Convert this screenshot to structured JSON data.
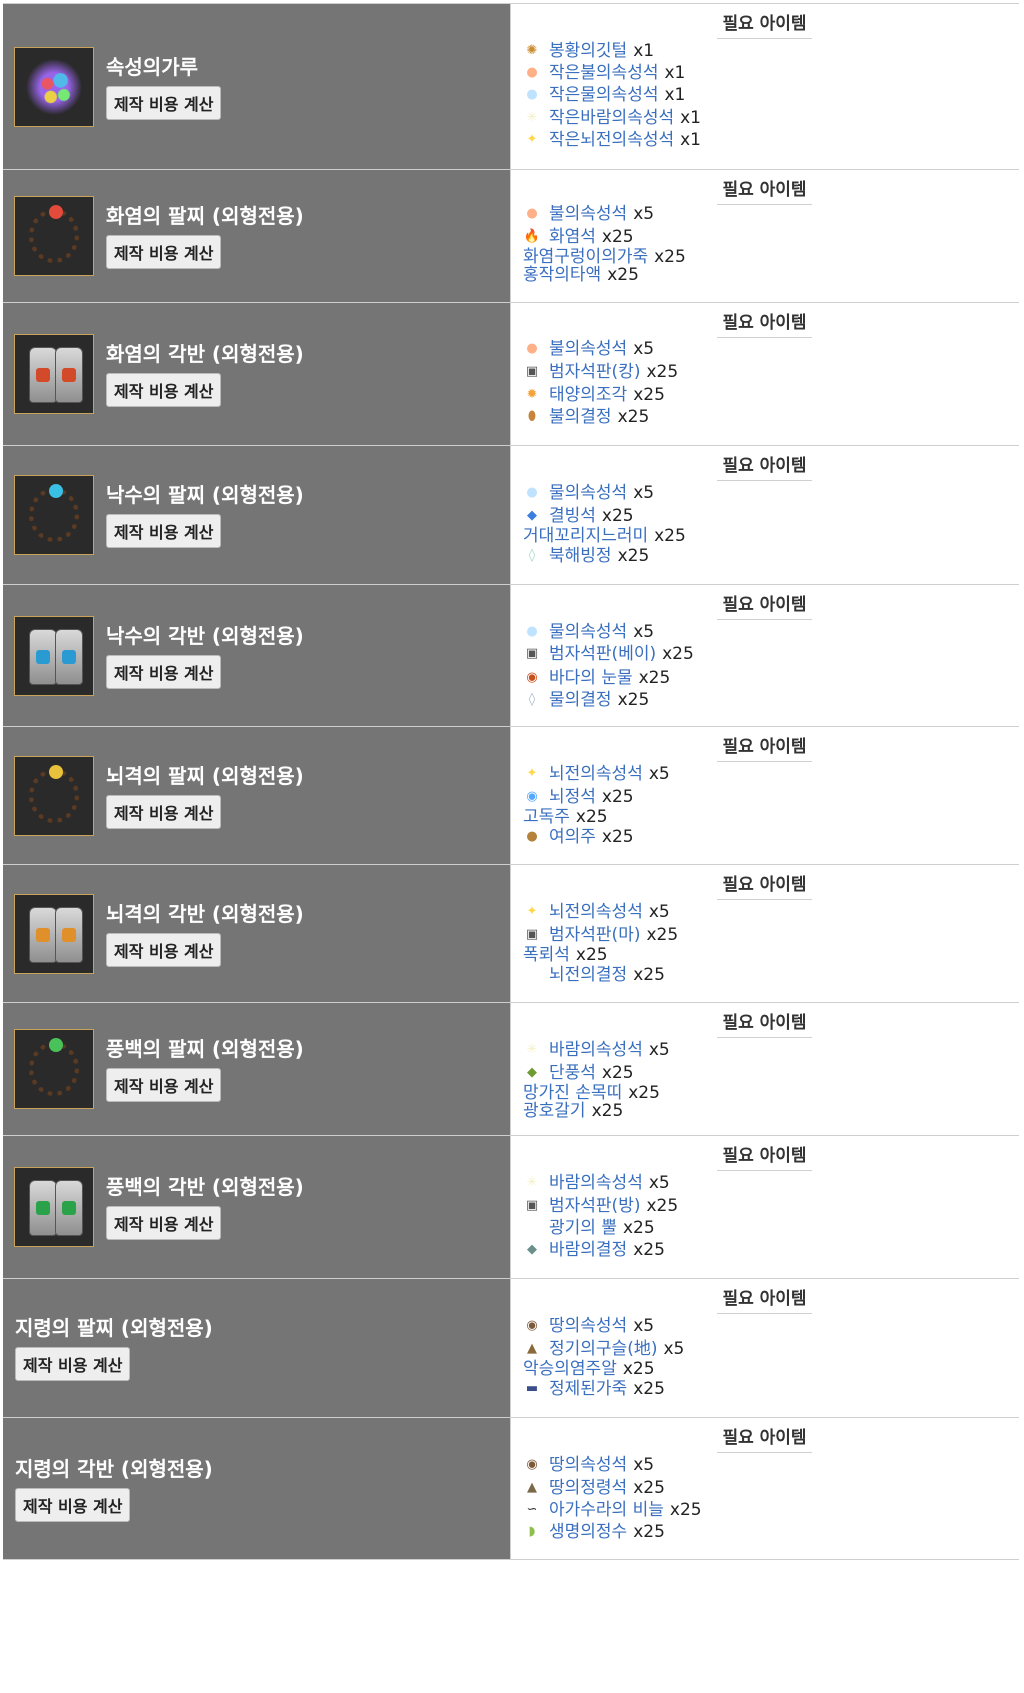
{
  "header_label": "필요 아이템",
  "button_label": "제작 비용 계산",
  "rows": [
    {
      "name": "속성의가루",
      "thumb": "powder",
      "materials": [
        {
          "icon": "feather-icon",
          "name": "봉황의깃털",
          "qty": "x1"
        },
        {
          "icon": "fire-stone-icon",
          "name": "작은불의속성석",
          "qty": "x1"
        },
        {
          "icon": "water-stone-icon",
          "name": "작은물의속성석",
          "qty": "x1"
        },
        {
          "icon": "wind-stone-icon",
          "name": "작은바람의속성석",
          "qty": "x1"
        },
        {
          "icon": "lightning-stone-icon",
          "name": "작은뇌전의속성석",
          "qty": "x1"
        }
      ]
    },
    {
      "name": "화염의 팔찌 (외형전용)",
      "thumb": "bracelet-red",
      "materials": [
        {
          "icon": "fire-stone-icon",
          "name": "불의속성석",
          "qty": "x5"
        },
        {
          "icon": "flame-stone-icon",
          "name": "화염석",
          "qty": "x25"
        },
        {
          "icon": "",
          "name": "화염구렁이의가죽",
          "qty": "x25"
        },
        {
          "icon": "",
          "name": "홍작의타액",
          "qty": "x25"
        }
      ]
    },
    {
      "name": "화염의 각반 (외형전용)",
      "thumb": "greaves-red",
      "materials": [
        {
          "icon": "fire-stone-icon",
          "name": "불의속성석",
          "qty": "x5"
        },
        {
          "icon": "tablet-icon",
          "name": "범자석판(캉)",
          "qty": "x25"
        },
        {
          "icon": "sun-shard-icon",
          "name": "태양의조각",
          "qty": "x25"
        },
        {
          "icon": "fire-crystal-icon",
          "name": "불의결정",
          "qty": "x25"
        }
      ]
    },
    {
      "name": "낙수의 팔찌 (외형전용)",
      "thumb": "bracelet-blue",
      "materials": [
        {
          "icon": "water-stone-icon",
          "name": "물의속성석",
          "qty": "x5"
        },
        {
          "icon": "ice-stone-icon",
          "name": "결빙석",
          "qty": "x25"
        },
        {
          "icon": "",
          "name": "거대꼬리지느러미",
          "qty": "x25"
        },
        {
          "icon": "ice-crystal-icon",
          "name": "북해빙정",
          "qty": "x25"
        }
      ]
    },
    {
      "name": "낙수의 각반 (외형전용)",
      "thumb": "greaves-blue",
      "materials": [
        {
          "icon": "water-stone-icon",
          "name": "물의속성석",
          "qty": "x5"
        },
        {
          "icon": "tablet-icon",
          "name": "범자석판(베이)",
          "qty": "x25"
        },
        {
          "icon": "tear-drop-icon",
          "name": "바다의 눈물",
          "qty": "x25"
        },
        {
          "icon": "water-crystal-icon",
          "name": "물의결정",
          "qty": "x25"
        }
      ]
    },
    {
      "name": "뇌격의 팔찌 (외형전용)",
      "thumb": "bracelet-yellow",
      "materials": [
        {
          "icon": "lightning-stone-icon",
          "name": "뇌전의속성석",
          "qty": "x5"
        },
        {
          "icon": "thunder-stone-icon",
          "name": "뇌정석",
          "qty": "x25"
        },
        {
          "icon": "",
          "name": "고독주",
          "qty": "x25"
        },
        {
          "icon": "orb-icon",
          "name": "여의주",
          "qty": "x25"
        }
      ]
    },
    {
      "name": "뇌격의 각반 (외형전용)",
      "thumb": "greaves-yellow",
      "materials": [
        {
          "icon": "lightning-stone-icon",
          "name": "뇌전의속성석",
          "qty": "x5"
        },
        {
          "icon": "tablet-icon",
          "name": "범자석판(마)",
          "qty": "x25"
        },
        {
          "icon": "",
          "name": "폭뢰석",
          "qty": "x25"
        },
        {
          "icon": "lightning-crystal-icon",
          "name": "뇌전의결정",
          "qty": "x25"
        }
      ]
    },
    {
      "name": "풍백의 팔찌 (외형전용)",
      "thumb": "bracelet-green",
      "materials": [
        {
          "icon": "wind-stone-icon",
          "name": "바람의속성석",
          "qty": "x5"
        },
        {
          "icon": "leaf-stone-icon",
          "name": "단풍석",
          "qty": "x25"
        },
        {
          "icon": "",
          "name": "망가진 손목띠",
          "qty": "x25"
        },
        {
          "icon": "",
          "name": "광호갈기",
          "qty": "x25"
        }
      ]
    },
    {
      "name": "풍백의 각반 (외형전용)",
      "thumb": "greaves-green",
      "materials": [
        {
          "icon": "wind-stone-icon",
          "name": "바람의속성석",
          "qty": "x5"
        },
        {
          "icon": "tablet-icon",
          "name": "범자석판(방)",
          "qty": "x25"
        },
        {
          "icon": "horn-icon",
          "name": "광기의 뿔",
          "qty": "x25"
        },
        {
          "icon": "wind-crystal-icon",
          "name": "바람의결정",
          "qty": "x25"
        }
      ]
    },
    {
      "name": "지령의 팔찌 (외형전용)",
      "thumb": "",
      "materials": [
        {
          "icon": "earth-stone-icon",
          "name": "땅의속성석",
          "qty": "x5"
        },
        {
          "icon": "energy-bead-icon",
          "name": "정기의구슬(地)",
          "qty": "x5"
        },
        {
          "icon": "",
          "name": "악승의염주알",
          "qty": "x25"
        },
        {
          "icon": "leather-icon",
          "name": "정제된가죽",
          "qty": "x25"
        }
      ]
    },
    {
      "name": "지령의 각반 (외형전용)",
      "thumb": "",
      "materials": [
        {
          "icon": "earth-stone-icon",
          "name": "땅의속성석",
          "qty": "x5"
        },
        {
          "icon": "earth-spirit-icon",
          "name": "땅의정령석",
          "qty": "x25"
        },
        {
          "icon": "scale-icon",
          "name": "아가수라의 비늘",
          "qty": "x25"
        },
        {
          "icon": "essence-icon",
          "name": "생명의정수",
          "qty": "x25"
        }
      ]
    }
  ]
}
